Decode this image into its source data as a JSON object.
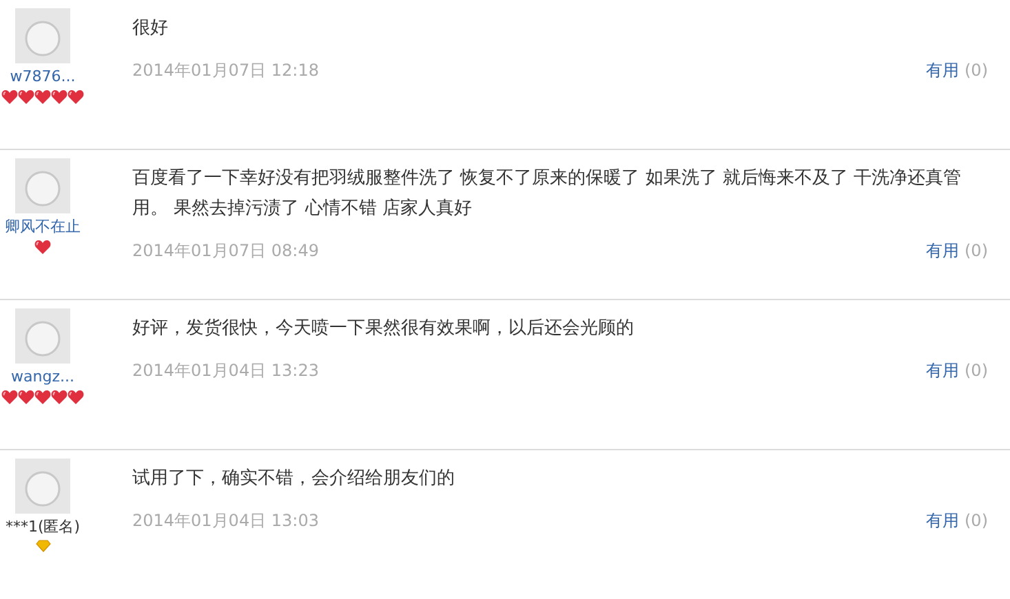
{
  "reviews": [
    {
      "user": "w7876...",
      "anonymous": false,
      "badges": [
        {
          "kind": "heart"
        },
        {
          "kind": "heart"
        },
        {
          "kind": "heart"
        },
        {
          "kind": "heart"
        },
        {
          "kind": "heart"
        }
      ],
      "text": "很好",
      "date": "2014年01月07日 12:18",
      "useful": "有用",
      "useful_count": "(0)"
    },
    {
      "user": "卿风不在止",
      "anonymous": false,
      "badges": [
        {
          "kind": "heart"
        }
      ],
      "text": "百度看了一下幸好没有把羽绒服整件洗了 恢复不了原来的保暖了 如果洗了 就后悔来不及了 干洗净还真管用。 果然去掉污渍了 心情不错 店家人真好",
      "date": "2014年01月07日 08:49",
      "useful": "有用",
      "useful_count": "(0)"
    },
    {
      "user": "wangz...",
      "anonymous": false,
      "badges": [
        {
          "kind": "heart"
        },
        {
          "kind": "heart"
        },
        {
          "kind": "heart"
        },
        {
          "kind": "heart"
        },
        {
          "kind": "heart"
        }
      ],
      "text": "好评，发货很快，今天喷一下果然很有效果啊，以后还会光顾的",
      "date": "2014年01月04日 13:23",
      "useful": "有用",
      "useful_count": "(0)"
    },
    {
      "user": "***1(匿名)",
      "anonymous": true,
      "badges": [
        {
          "kind": "diamond"
        }
      ],
      "text": "试用了下，确实不错，会介绍给朋友们的",
      "date": "2014年01月04日 13:03",
      "useful": "有用",
      "useful_count": "(0)"
    }
  ]
}
